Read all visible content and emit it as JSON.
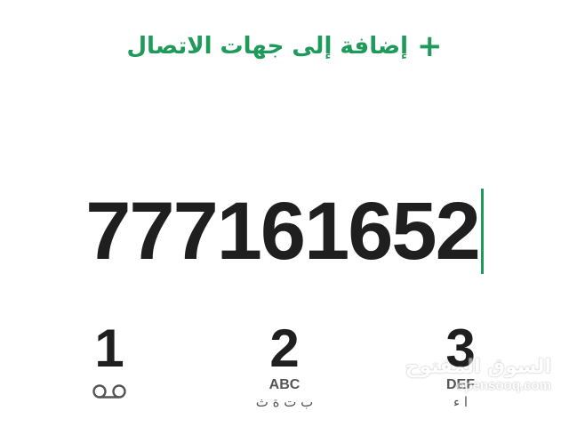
{
  "header": {
    "add_contact_icon": "+",
    "add_contact_label": "إضافة إلى جهات الاتصال"
  },
  "dialer": {
    "number": "777161652"
  },
  "keypad": {
    "keys": [
      {
        "digit": "1",
        "latin": "",
        "arabic": "",
        "icon": "voicemail-icon"
      },
      {
        "digit": "2",
        "latin": "ABC",
        "arabic": "ب ت ة ث"
      },
      {
        "digit": "3",
        "latin": "DEF",
        "arabic": "ا ء"
      }
    ]
  },
  "watermark": {
    "arabic": "السوق المفتوح",
    "latin": "opensooq.com"
  },
  "colors": {
    "accent": "#1e9a5a",
    "text": "#1f1f1f",
    "subtext": "#555555"
  }
}
